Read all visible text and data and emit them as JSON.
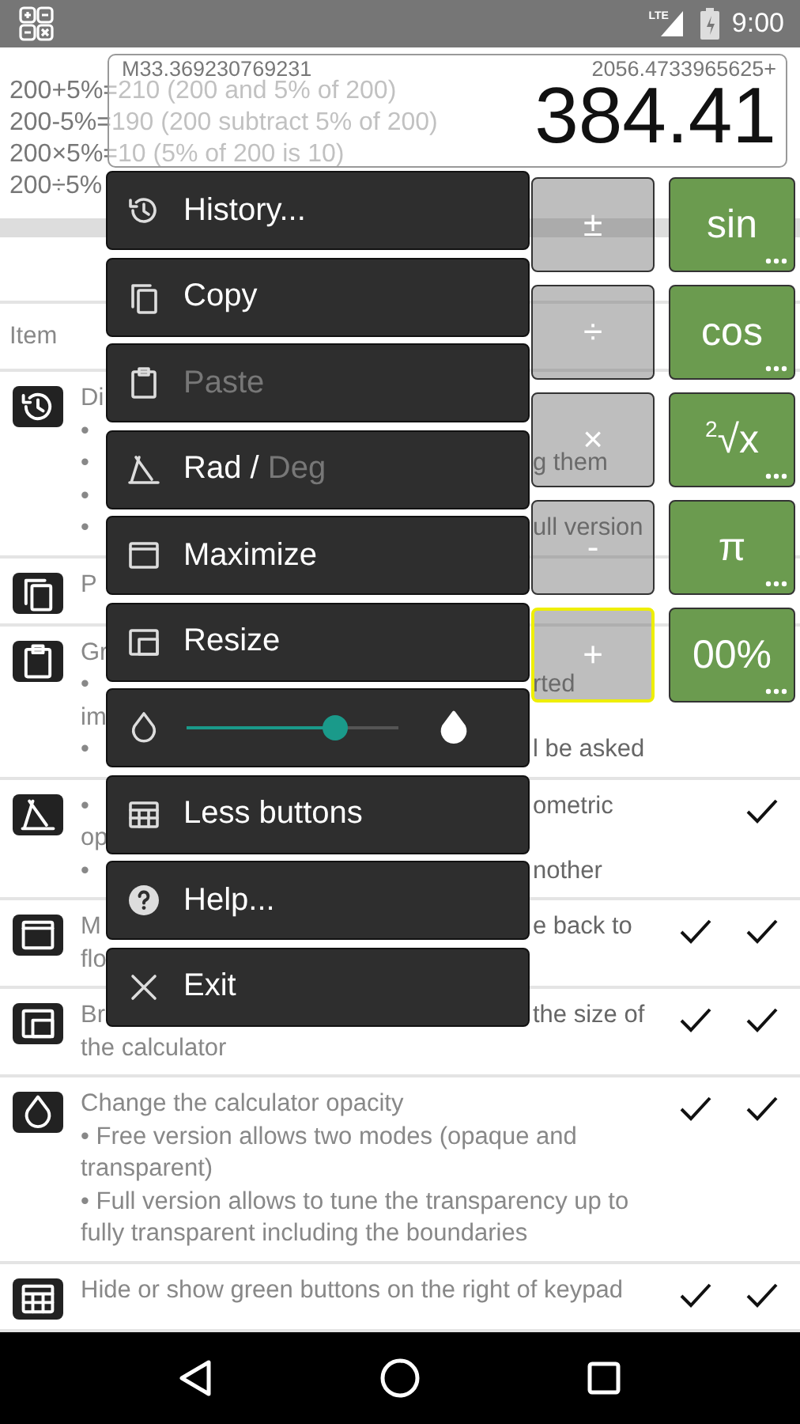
{
  "status_bar": {
    "network": "LTE",
    "time": "9:00"
  },
  "examples": [
    "200+5%=210 (200 and 5% of 200)",
    "200-5%=190 (200 subtract 5% of 200)",
    "200×5%=10 (5% of 200 is 10)",
    "200÷5%"
  ],
  "display": {
    "memory": "M33.369230769231",
    "expression": "2056.4733965625+",
    "value": "384.41"
  },
  "help_table": {
    "columns": [
      {
        "label": "Item"
      }
    ],
    "rows": [
      {
        "lines": [
          {
            "left": "Di"
          },
          {
            "left": "•"
          },
          {
            "left": "•",
            "right": "g them"
          },
          {
            "left": "•"
          },
          {
            "left": "•",
            "right": "ull version"
          }
        ]
      },
      {
        "lines": [
          {
            "left": "P"
          }
        ]
      },
      {
        "lines": [
          {
            "left": "Gr"
          },
          {
            "left": "•",
            "right": "rted"
          },
          {
            "left": "im"
          },
          {
            "left": "•",
            "right": "l be asked"
          }
        ]
      },
      {
        "lines": [
          {
            "left": "•",
            "right": "ometric"
          },
          {
            "left": "op"
          },
          {
            "left": "•",
            "right": "nother"
          }
        ],
        "check_1": false,
        "check_2": true
      },
      {
        "lines": [
          {
            "left": "M",
            "right": "e back to"
          },
          {
            "left": "flo"
          }
        ],
        "check_1": true,
        "check_2": true
      },
      {
        "lines": [
          {
            "left": "Br",
            "right": "the size of"
          },
          {
            "text": "the calculator"
          }
        ],
        "check_1": true,
        "check_2": true
      },
      {
        "lines": [
          {
            "text": "Change the calculator opacity"
          },
          {
            "text": "• Free version allows two modes (opaque and transparent)"
          },
          {
            "text": "• Full version allows to tune the transparency up to fully transparent including the boundaries"
          }
        ],
        "check_1": true,
        "check_2": true
      },
      {
        "lines": [
          {
            "text": "Hide or show green buttons on the right of keypad"
          }
        ],
        "check_1": true,
        "check_2": true
      }
    ]
  },
  "keypad": {
    "keys": [
      {
        "label": "±",
        "kind": "operator",
        "highlighted": false
      },
      {
        "label": "sin",
        "kind": "function",
        "highlighted": false
      },
      {
        "label": "÷",
        "kind": "operator",
        "highlighted": false
      },
      {
        "label": "cos",
        "kind": "function",
        "highlighted": false
      },
      {
        "label": "×",
        "kind": "operator",
        "highlighted": false
      },
      {
        "label": "$^{2}$√x",
        "kind": "function",
        "highlighted": false
      },
      {
        "label": "-",
        "kind": "operator",
        "highlighted": false
      },
      {
        "label": "π",
        "kind": "function",
        "highlighted": false
      },
      {
        "label": "+",
        "kind": "operator",
        "highlighted": true
      },
      {
        "label": "00%",
        "kind": "function",
        "highlighted": false
      }
    ]
  },
  "menu": {
    "items": [
      {
        "kind": "action",
        "label": "History...",
        "disabled": false
      },
      {
        "kind": "action",
        "label": "Copy",
        "disabled": false
      },
      {
        "kind": "action",
        "label": "Paste",
        "disabled": true
      },
      {
        "kind": "toggle",
        "separator": "/",
        "options": [
          {
            "label": "Rad",
            "selected": true
          },
          {
            "label": "Deg",
            "selected": false
          }
        ]
      },
      {
        "kind": "action",
        "label": "Maximize",
        "disabled": false
      },
      {
        "kind": "action",
        "label": "Resize",
        "disabled": false
      },
      {
        "kind": "slider",
        "level": 0.7
      },
      {
        "kind": "action",
        "label": "Less buttons",
        "disabled": false
      },
      {
        "kind": "action",
        "label": "Help...",
        "disabled": false
      },
      {
        "kind": "action",
        "label": "Exit",
        "disabled": false
      }
    ]
  }
}
